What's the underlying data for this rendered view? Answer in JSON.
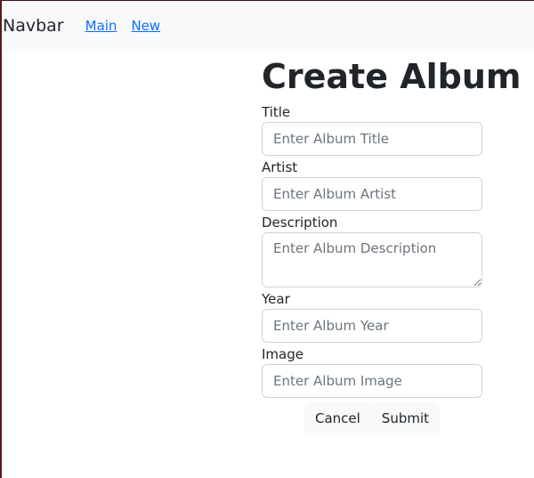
{
  "navbar": {
    "brand": "Navbar",
    "links": [
      {
        "label": "Main"
      },
      {
        "label": "New"
      }
    ]
  },
  "form": {
    "title": "Create Album",
    "fields": {
      "title": {
        "label": "Title",
        "placeholder": "Enter Album Title",
        "value": ""
      },
      "artist": {
        "label": "Artist",
        "placeholder": "Enter Album Artist",
        "value": ""
      },
      "description": {
        "label": "Description",
        "placeholder": "Enter Album Description",
        "value": ""
      },
      "year": {
        "label": "Year",
        "placeholder": "Enter Album Year",
        "value": ""
      },
      "image": {
        "label": "Image",
        "placeholder": "Enter Album Image",
        "value": ""
      }
    },
    "buttons": {
      "cancel": "Cancel",
      "submit": "Submit"
    }
  },
  "colors": {
    "navbar_bg": "#f8f9fa",
    "link": "#0d6efd",
    "text": "#212529",
    "placeholder": "#6c757d",
    "input_border": "#ced4da"
  }
}
